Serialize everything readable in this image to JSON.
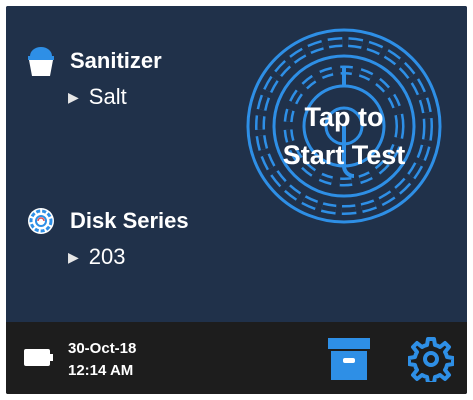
{
  "sanitizer": {
    "label": "Sanitizer",
    "value": "Salt",
    "icon": "bucket-icon"
  },
  "disk": {
    "label": "Disk Series",
    "value": "203",
    "icon": "disk-icon"
  },
  "start": {
    "line1": "Tap to",
    "line2": "Start Test"
  },
  "footer": {
    "date": "30-Oct-18",
    "time": "12:14 AM",
    "battery_icon": "battery-icon",
    "archive_icon": "archive-icon",
    "settings_icon": "gear-icon"
  },
  "colors": {
    "background": "#20314a",
    "footer": "#1d1d1d",
    "accent": "#2e8fe6",
    "text": "#ffffff"
  }
}
